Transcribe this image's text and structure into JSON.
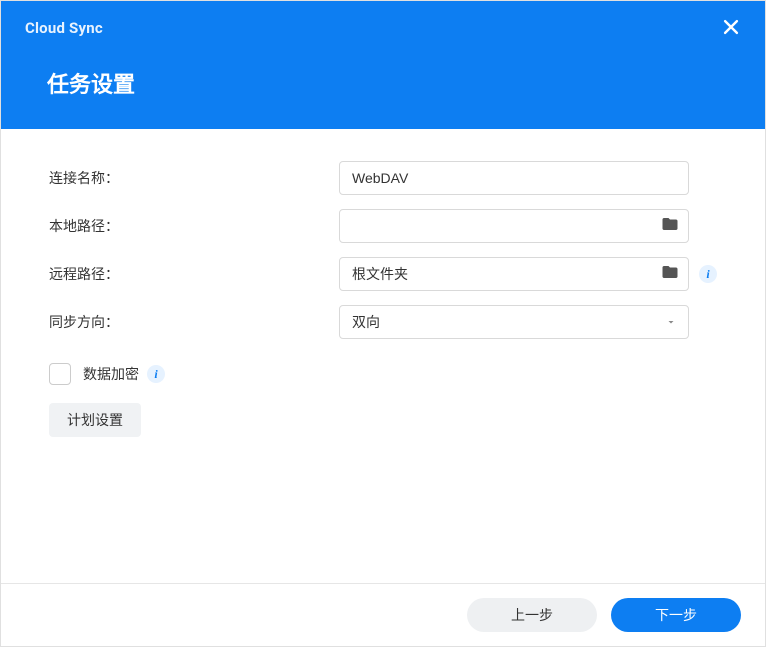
{
  "header": {
    "app_title": "Cloud Sync",
    "page_title": "任务设置"
  },
  "form": {
    "connection_name": {
      "label": "连接名称：",
      "value": "WebDAV"
    },
    "local_path": {
      "label": "本地路径：",
      "value": ""
    },
    "remote_path": {
      "label": "远程路径：",
      "value": "根文件夹"
    },
    "sync_direction": {
      "label": "同步方向：",
      "selected": "双向"
    },
    "encrypt": {
      "label": "数据加密",
      "checked": false
    },
    "schedule_button": "计划设置"
  },
  "footer": {
    "prev": "上一步",
    "next": "下一步"
  },
  "icons": {
    "close": "close-icon",
    "folder": "folder-icon",
    "info": "info-icon",
    "caret": "chevron-down-icon"
  },
  "colors": {
    "primary": "#0d7ef2"
  }
}
